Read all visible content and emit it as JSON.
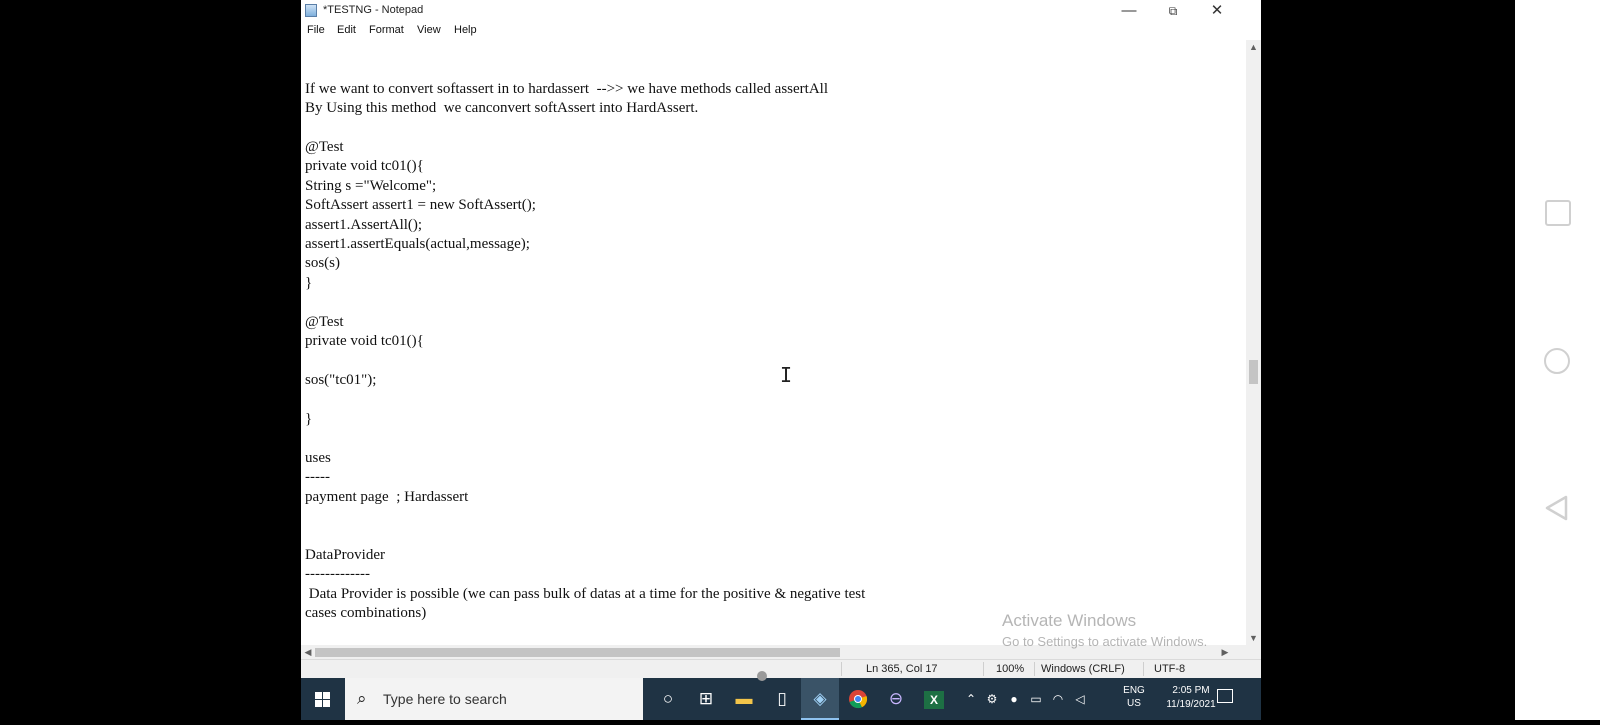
{
  "window": {
    "title": "*TESTNG - Notepad",
    "minimize": "—",
    "restore": "⧉",
    "close": "✕"
  },
  "menu": [
    "File",
    "Edit",
    "Format",
    "View",
    "Help"
  ],
  "editor": {
    "lines": [
      "If we want to convert softassert in to hardassert  -->> we have methods called assertAll",
      "By Using this method  we canconvert softAssert into HardAssert.",
      "",
      "@Test",
      "private void tc01(){",
      "String s =\"Welcome\";",
      "SoftAssert assert1 = new SoftAssert();",
      "assert1.AssertAll();",
      "assert1.assertEquals(actual,message);",
      "sos(s)",
      "}",
      "",
      "@Test",
      "private void tc01(){",
      "",
      "sos(\"tc01\");",
      "",
      "}",
      "",
      "uses",
      "-----",
      "payment page  ; Hardassert",
      "",
      "",
      "DataProvider",
      "-------------",
      " Data Provider is possible (we can pass bulk of datas at a time for the positive & negative test",
      "cases combinations)"
    ]
  },
  "watermark": {
    "line1": "Activate Windows",
    "line2": "Go to Settings to activate Windows."
  },
  "statusbar": {
    "position": "Ln 365, Col 17",
    "zoom": "100%",
    "line_ending": "Windows (CRLF)",
    "encoding": "UTF-8"
  },
  "taskbar": {
    "search_placeholder": "Type here to search",
    "lang_line1": "ENG",
    "lang_line2": "US",
    "time": "2:05 PM",
    "date": "11/19/2021"
  }
}
